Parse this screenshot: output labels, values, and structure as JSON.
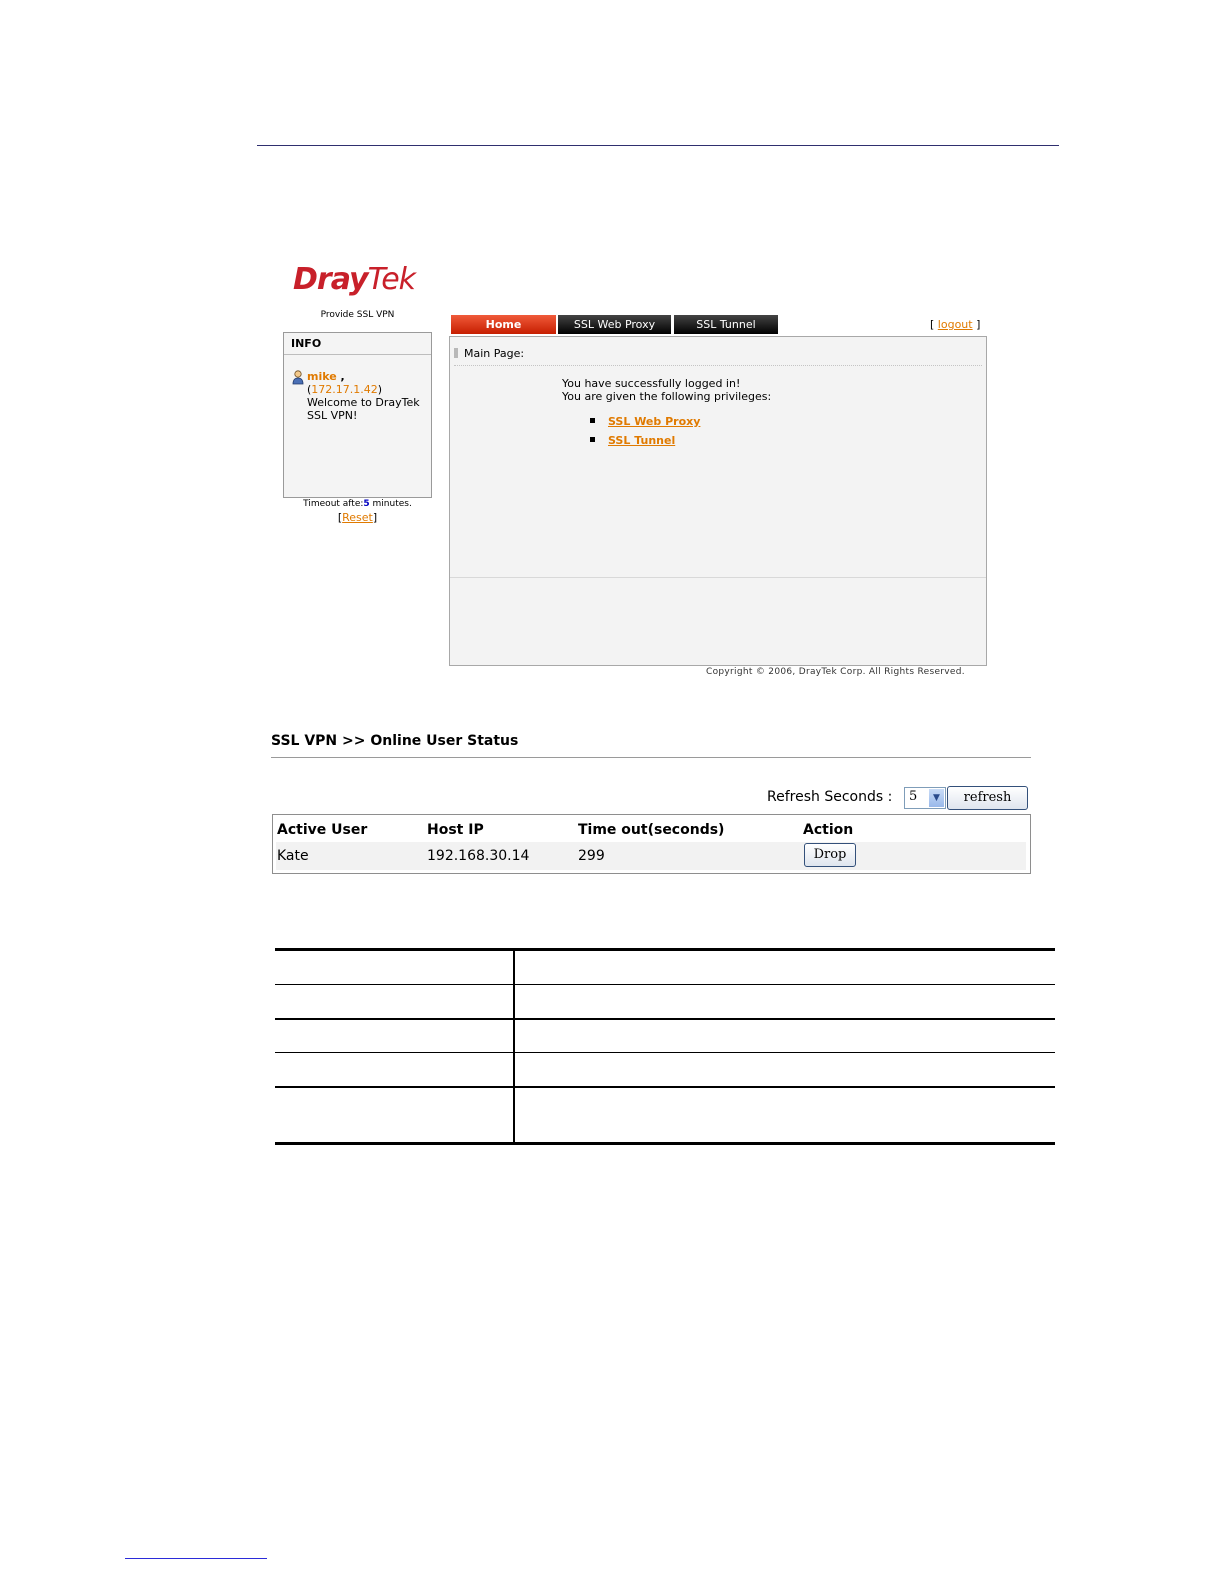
{
  "portal": {
    "logo_bold": "Dray",
    "logo_light": "Tek",
    "tagline": "Provide SSL VPN",
    "tabs": [
      {
        "label": "Home"
      },
      {
        "label": "SSL Web Proxy"
      },
      {
        "label": "SSL Tunnel"
      }
    ],
    "logout": {
      "bracket_open": "[ ",
      "label": "logout",
      "bracket_close": " ]"
    },
    "info": {
      "title": "INFO",
      "username": "mike",
      "username_suffix": " ,",
      "ip_open": "(",
      "ip": "172.17.1.42",
      "ip_close": ")",
      "welcome": "Welcome to DrayTek SSL VPN!"
    },
    "timeout": {
      "prefix": "Timeout afte:",
      "value": "5",
      "suffix": " minutes."
    },
    "reset": {
      "bracket_open": "[",
      "label": "Reset",
      "bracket_close": "]"
    },
    "main": {
      "heading": "Main Page:",
      "message_1": "You have successfully logged in!",
      "message_2": "You are given the following privileges:",
      "privileges": [
        {
          "label": "SSL Web Proxy"
        },
        {
          "label": "SSL Tunnel"
        }
      ]
    },
    "copyright": "Copyright © 2006, DrayTek Corp. All Rights Reserved."
  },
  "online_status": {
    "title": "SSL VPN >> Online User Status",
    "refresh_label": "Refresh Seconds :",
    "refresh_value": "5",
    "refresh_button": "refresh",
    "columns": [
      "Active User",
      "Host IP",
      "Time out(seconds)",
      "Action"
    ],
    "rows": [
      {
        "user": "Kate",
        "host_ip": "192.168.30.14",
        "timeout": "299",
        "action": "Drop"
      }
    ]
  }
}
